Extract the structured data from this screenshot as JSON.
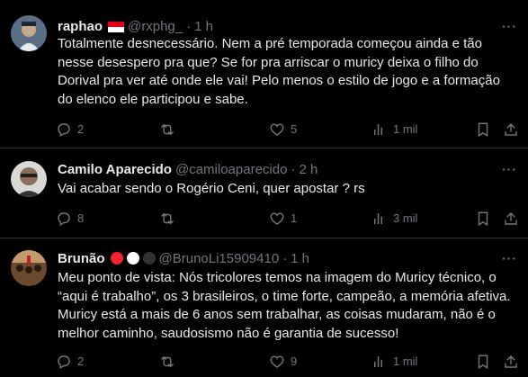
{
  "tweets": [
    {
      "name": "raphao",
      "handle": "@rxphg_",
      "time": "1 h",
      "text": "Totalmente desnecessário. Nem a pré temporada começou ainda e tão nesse desespero pra que? Se for pra arriscar o muricy deixa o filho do Dorival pra ver até onde ele vai! Pelo menos o estilo de jogo e a formação do elenco ele participou e sabe.",
      "replies": "2",
      "reposts": "",
      "likes": "5",
      "views": "1 mil"
    },
    {
      "name": "Camilo Aparecido",
      "handle": "@camiloaparecido",
      "time": "2 h",
      "text": "Vai acabar sendo o Rogério Ceni, quer apostar ? rs",
      "replies": "8",
      "reposts": "",
      "likes": "1",
      "views": "3 mil"
    },
    {
      "name": "Brunão",
      "handle": "@BrunoLi15909410",
      "time": "1 h",
      "text": "Meu ponto de vista: Nós tricolores temos na imagem do Muricy técnico, o “aqui é trabalho”, os 3 brasileiros, o time forte, campeão, a memória afetiva. Muricy está a mais de 6 anos sem trabalhar, as coisas mudaram, não é o melhor caminho, saudosismo não é garantia de sucesso!",
      "replies": "2",
      "reposts": "",
      "likes": "9",
      "views": "1 mil"
    }
  ],
  "separator": "·",
  "more_label": "···",
  "colors": {
    "background": "#000000",
    "text": "#e7e9ea",
    "muted": "#71767b",
    "divider": "#2f3336",
    "flag_red": "#e0001b",
    "dot_red": "#f4212e",
    "dot_white": "#ffffff",
    "dot_black": "#333333"
  }
}
